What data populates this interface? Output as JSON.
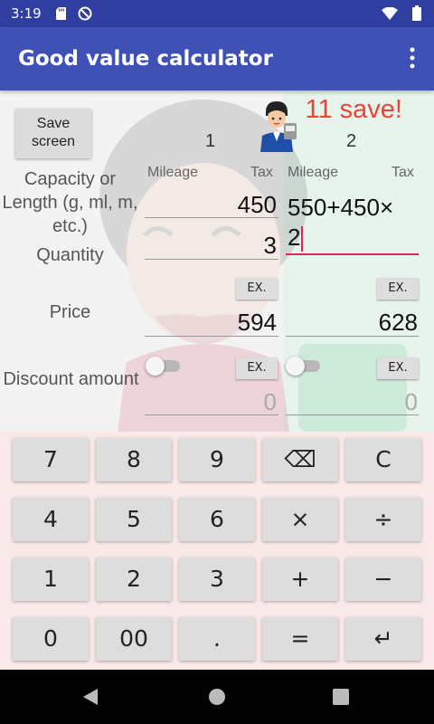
{
  "status_bar": {
    "time": "3:19"
  },
  "app_bar": {
    "title": "Good value calculator"
  },
  "form": {
    "save_button": {
      "line1": "Save",
      "line2": "screen"
    },
    "save_message": "11 save!",
    "columns": [
      {
        "number": "1",
        "mileage_label": "Mileage",
        "tax_label": "Tax"
      },
      {
        "number": "2",
        "mileage_label": "Mileage",
        "tax_label": "Tax"
      }
    ],
    "row_labels": {
      "capacity": "Capacity or Length (g, ml, m, etc.)",
      "quantity": "Quantity",
      "price": "Price",
      "discount": "Discount amount"
    },
    "col1": {
      "capacity": "450",
      "quantity": "3",
      "price": "594",
      "discount": "0"
    },
    "col2": {
      "expression_line1": "550+450×",
      "expression_line2": "2",
      "price": "628",
      "discount": "0"
    },
    "ex_label": "EX.",
    "discount_toggles": [
      {
        "on": false
      },
      {
        "on": false
      }
    ]
  },
  "keypad": {
    "rows": [
      [
        "7",
        "8",
        "9",
        "⌫",
        "C"
      ],
      [
        "4",
        "5",
        "6",
        "×",
        "÷"
      ],
      [
        "1",
        "2",
        "3",
        "+",
        "−"
      ],
      [
        "0",
        "00",
        ".",
        "=",
        "↵"
      ]
    ]
  },
  "colors": {
    "status_bar": "#303f9f",
    "app_bar": "#3f51b5",
    "save_text": "#e8443a",
    "accent": "#e91e63",
    "column2_bg": "#e6f4ec",
    "keypad_bg": "#fae9e9"
  }
}
